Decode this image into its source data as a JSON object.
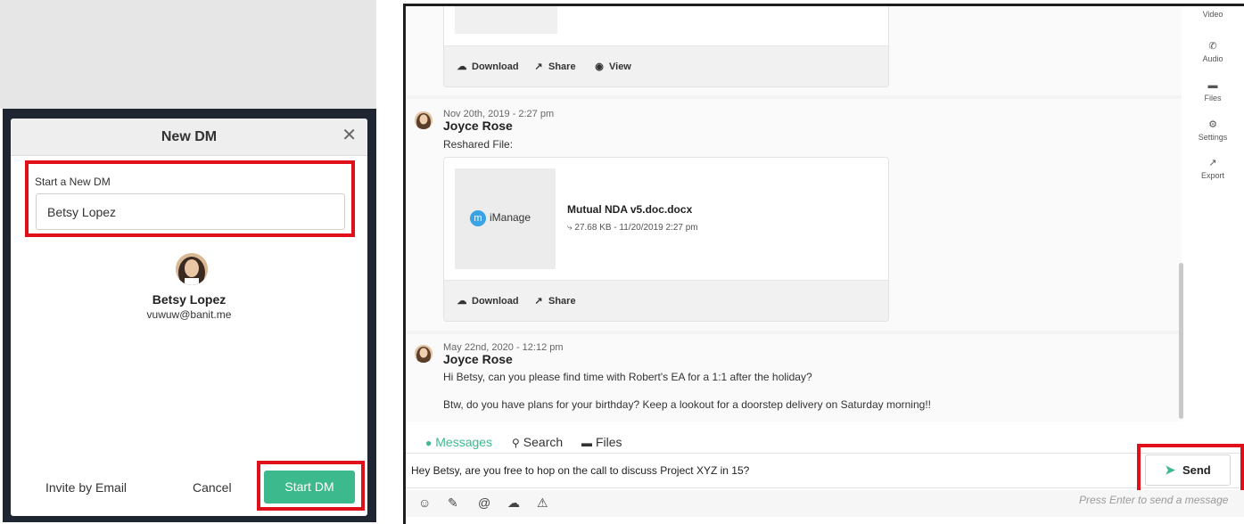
{
  "new_dm_modal": {
    "title": "New DM",
    "close_icon": "close-icon",
    "field_label": "Start a New DM",
    "field_value": "Betsy Lopez",
    "contact": {
      "name": "Betsy Lopez",
      "email": "vuwuw@banit.me"
    },
    "invite_label": "Invite by Email",
    "cancel_label": "Cancel",
    "start_label": "Start DM",
    "accent_color": "#3dba8d",
    "highlight_color": "#e0101a"
  },
  "chat": {
    "first_card_actions": {
      "download": "Download",
      "share": "Share",
      "view": "View"
    },
    "messages": [
      {
        "time": "Nov 20th, 2019 - 2:27 pm",
        "author": "Joyce Rose",
        "text": "Reshared File:",
        "file": {
          "logo": "iManage",
          "name": "Mutual NDA v5.doc.docx",
          "meta": "27.68 KB - 11/20/2019 2:27 pm"
        },
        "actions": {
          "download": "Download",
          "share": "Share"
        }
      },
      {
        "time": "May 22nd, 2020 - 12:12 pm",
        "author": "Joyce Rose",
        "lines": [
          "Hi Betsy, can you please find time with Robert's EA for a 1:1 after the holiday?",
          "Btw, do you have plans for your birthday?  Keep a lookout for a doorstep delivery on Saturday morning!!"
        ]
      }
    ]
  },
  "sidebar": {
    "items": [
      {
        "label": "Video",
        "icon": "video-icon"
      },
      {
        "label": "Audio",
        "icon": "phone-icon"
      },
      {
        "label": "Files",
        "icon": "folder-icon"
      },
      {
        "label": "Settings",
        "icon": "gear-icon"
      },
      {
        "label": "Export",
        "icon": "export-icon"
      }
    ]
  },
  "tabs": [
    {
      "label": "Messages",
      "icon": "chat-bubble-icon",
      "active": true
    },
    {
      "label": "Search",
      "icon": "search-icon",
      "active": false
    },
    {
      "label": "Files",
      "icon": "folder-icon",
      "active": false
    }
  ],
  "composer": {
    "value": "Hey Betsy, are you free to hop on the call to discuss Project XYZ in 15?",
    "send_label": "Send",
    "hint": "Press Enter to send a message"
  }
}
